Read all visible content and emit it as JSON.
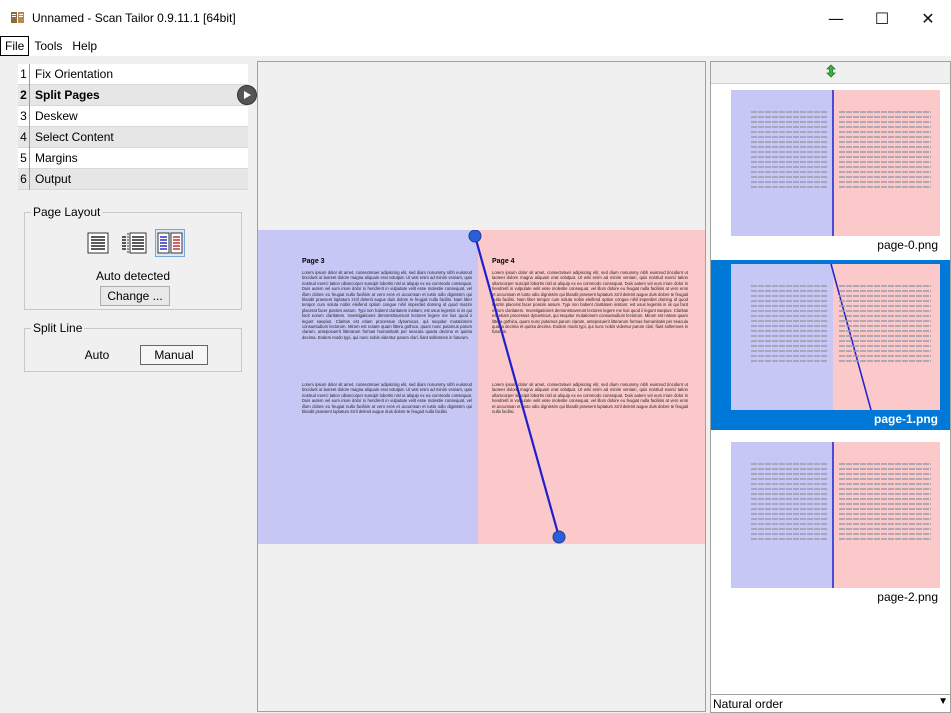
{
  "window": {
    "title": "Unnamed - Scan Tailor 0.9.11.1 [64bit]",
    "minimize": "—",
    "maximize": "☐",
    "close": "✕"
  },
  "menu": [
    "File",
    "Tools",
    "Help"
  ],
  "stages": [
    {
      "num": "1",
      "label": "Fix Orientation"
    },
    {
      "num": "2",
      "label": "Split Pages"
    },
    {
      "num": "3",
      "label": "Deskew"
    },
    {
      "num": "4",
      "label": "Select Content"
    },
    {
      "num": "5",
      "label": "Margins"
    },
    {
      "num": "6",
      "label": "Output"
    }
  ],
  "current_stage": 2,
  "page_layout": {
    "title": "Page Layout",
    "options": [
      "single-page-uncut-icon",
      "single-page-cut-icon",
      "two-pages-icon"
    ],
    "selected": "two-pages-icon",
    "status": "Auto detected",
    "change_button": "Change ..."
  },
  "split_line": {
    "title": "Split Line",
    "auto_button": "Auto",
    "manual_button": "Manual",
    "selected": "Manual"
  },
  "preview": {
    "left_heading": "Page 3",
    "right_heading": "Page 4",
    "left_para1": "Lorem ipsum dolor sit amet, consectetuer adipiscing elit, sed diam nonummy nibh euismod tincidunt ut laoreet dolore magna aliquam erat volutpat. Ut wisi enim ad minim veniam, quis nostrud exerci tation ullamcorper suscipit lobortis nisl ut aliquip ex ea commodo consequat. Duis autem vel eum iriure dolor in hendrerit in vulputate velit esse molestie consequat, vel illum dolore eu feugiat nulla facilisis at vero eros et accumsan et iusto odio dignissim qui blandit praesent luptatum zzril delenit augue duis dolore te feugait nulla facilisi. Nam liber tempor cum soluta nobis eleifend option congue nihil imperdiet doming id quod mazim placerat facer possim assum. Typi non habent claritatem insitam; est usus legentis in iis qui facit eorum claritatem. Investigationes demonstraverunt lectores legere me lius quod ii legunt saepius. Claritas est etiam processus dynamicus, qui sequitur mutationem consuetudium lectorum. Mirum est notare quam littera gothica, quam nunc putamus parum claram, anteposuerit litterarum formas humanitatis per seacula quarta decima et quinta decima. Eodem modo typi, qui nunc nobis videntur parum clari, fiant sollemnes in futurum.",
    "left_para2": "Lorem ipsum dolor sit amet, consectetuer adipiscing elit, sed diam nonummy nibh euismod tincidunt ut laoreet dolore magna aliquam erat volutpat. Ut wisi enim ad minim veniam, quis nostrud exerci tation ullamcorper suscipit lobortis nisl ut aliquip ex ea commodo consequat. Duis autem vel eum iriure dolor in hendrerit in vulputate velit esse molestie consequat, vel illum dolore eu feugiat nulla facilisis at vero eros et accumsan et iusto odio dignissim qui blandit praesent luptatum zzril delenit augue duis dolore te feugait nulla facilisi.",
    "right_para1": "Lorem ipsum dolor sit amet, consectetuer adipiscing elit, sed diam nonummy nibh euismod tincidunt ut laoreet dolore magna aliquam erat volutpat. Ut wisi enim ad minim veniam, quis nostrud exerci tation ullamcorper suscipit lobortis nisl ut aliquip ex ea commodo consequat. Duis autem vel eum iriure dolor in hendrerit in vulputate velit esse molestie consequat, vel illum dolore eu feugiat nulla facilisis at vero eros et accumsan et iusto odio dignissim qui blandit praesent luptatum zzril delenit augue duis dolore te feugait nulla facilisi. Nam liber tempor cum soluta nobis eleifend option congue nihil imperdiet doming id quod mazim placerat facer possim assum. Typi non habent claritatem insitam; est usus legentis in iis qui facit eorum claritatem. Investigationes demonstraverunt lectores legere me lius quod ii legunt saepius. Claritas est etiam processus dynamicus, qui sequitur mutationem consuetudium lectorum. Mirum est notare quam littera gothica, quam nunc putamus parum claram, anteposuerit litterarum formas humanitatis per seacula quarta decima et quinta decima. Eodem modo typi, qui nunc nobis videntur parum clari, fiant sollemnes in futurum.",
    "right_para2": "Lorem ipsum dolor sit amet, consectetuer adipiscing elit, sed diam nonummy nibh euismod tincidunt ut laoreet dolore magna aliquam erat volutpat. Ut wisi enim ad minim veniam, quis nostrud exerci tation ullamcorper suscipit lobortis nisl ut aliquip ex ea commodo consequat. Duis autem vel eum iriure dolor in hendrerit in vulputate velit esse molestie consequat, vel illum dolore eu feugiat nulla facilisis at vero eros et accumsan et iusto odio dignissim qui blandit praesent luptatum zzril delenit augue duis dolore te feugait nulla facilisi."
  },
  "thumbnails": [
    {
      "label": "page-0.png",
      "selected": false
    },
    {
      "label": "page-1.png",
      "selected": true
    },
    {
      "label": "page-2.png",
      "selected": false
    }
  ],
  "sort_order": "Natural order",
  "colors": {
    "left_page": "#c7c7f6",
    "right_page": "#fbc9c9",
    "selection": "#0078d7",
    "split_line": "#1f1fd0"
  }
}
